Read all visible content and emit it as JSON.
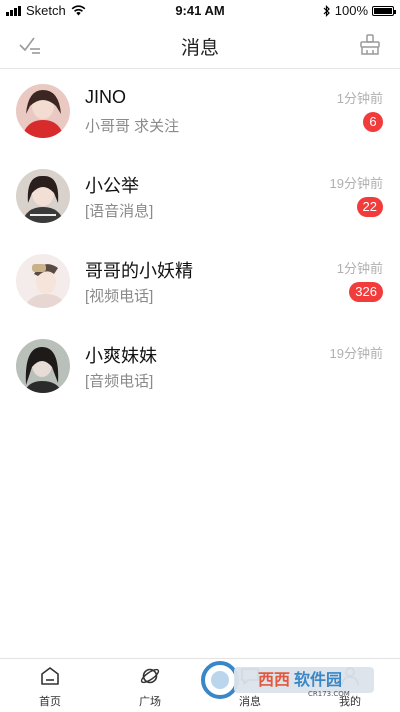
{
  "status_bar": {
    "carrier": "Sketch",
    "time": "9:41 AM",
    "battery_text": "100%"
  },
  "nav": {
    "title": "消息",
    "left_icon": "check-clear-icon",
    "right_icon": "clean-broom-icon"
  },
  "chats": [
    {
      "name": "JINO",
      "preview": "小哥哥 求关注",
      "time": "1分钟前",
      "unread": "6"
    },
    {
      "name": "小公举",
      "preview": "[语音消息]",
      "time": "19分钟前",
      "unread": "22"
    },
    {
      "name": "哥哥的小妖精",
      "preview": "[视频电话]",
      "time": "1分钟前",
      "unread": "326"
    },
    {
      "name": "小爽妹妹",
      "preview": "[音频电话]",
      "time": "19分钟前",
      "unread": ""
    }
  ],
  "tabs": [
    {
      "label": "首页",
      "icon": "home-icon"
    },
    {
      "label": "广场",
      "icon": "planet-icon"
    },
    {
      "label": "消息",
      "icon": "message-icon"
    },
    {
      "label": "我的",
      "icon": "profile-icon"
    }
  ],
  "watermark": {
    "text": "西西软件园",
    "subtext": "CR173.COM"
  },
  "colors": {
    "badge": "#f23b3b",
    "muted": "#8a8a8a",
    "time": "#b0b0b0"
  }
}
